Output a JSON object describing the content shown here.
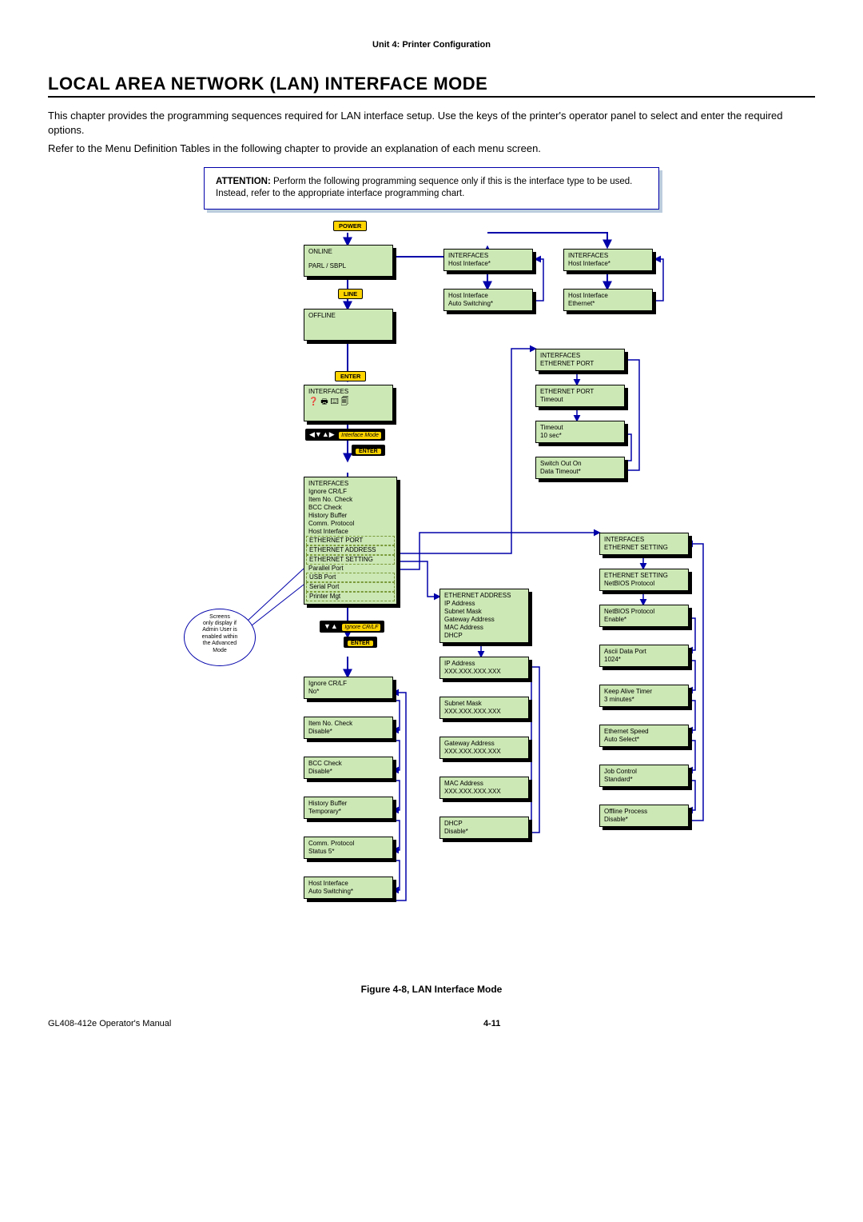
{
  "doc": {
    "unit": "Unit 4:  Printer Configuration",
    "heading": "LOCAL AREA NETWORK (LAN) INTERFACE MODE",
    "para1": "This chapter provides the programming sequences required for LAN interface setup. Use the keys of the printer's operator panel to select and enter the required options.",
    "para2": "Refer to the Menu Definition Tables in the following chapter to provide an explanation of each menu screen.",
    "attention_label": "ATTENTION:",
    "attention": " Perform the following programming sequence only if this is the interface type to be used. Instead, refer to the appropriate interface programming chart.",
    "fig_caption": "Figure 4-8, LAN Interface Mode",
    "footer_left": "GL408-412e Operator's Manual",
    "page_no": "4-11"
  },
  "buttons": {
    "power": "POWER",
    "line": "LINE",
    "enter": "ENTER",
    "interface_mode": "Interface Mode",
    "ignore_crlf": "Ignore CR/LF"
  },
  "col1": {
    "online_l1": "ONLINE",
    "online_l2": "PARL / SBPL",
    "offline": "OFFLINE",
    "interfaces": "INTERFACES",
    "list_title": "INTERFACES",
    "list": [
      "Ignore CR/LF",
      "Item No. Check",
      "BCC Check",
      "History Buffer",
      "Comm. Protocol",
      "Host Interface",
      "ETHERNET PORT",
      "ETHERNET ADDRESS",
      "ETHERNET SETTING",
      "Parallel Port",
      "USB Port",
      "Serial Port",
      "Printer Mgt"
    ],
    "n_ignore_l1": "Ignore CR/LF",
    "n_ignore_l2": "No*",
    "n_item_l1": "Item No. Check",
    "n_item_l2": "Disable*",
    "n_bcc_l1": "BCC Check",
    "n_bcc_l2": "Disable*",
    "n_hist_l1": "History Buffer",
    "n_hist_l2": "Temporary*",
    "n_comm_l1": "Comm. Protocol",
    "n_comm_l2": "Status 5*",
    "n_host_l1": "Host Interface",
    "n_host_l2": "Auto Switching*"
  },
  "col2a": {
    "if_l1": "INTERFACES",
    "if_l2": "Host Interface*",
    "hi_l1": "Host Interface",
    "hi_l2": "Auto Switching*"
  },
  "col2b": {
    "ep_l1": "INTERFACES",
    "ep_l2": "ETHERNET PORT",
    "ept_l1": "ETHERNET PORT",
    "ept_l2": "Timeout",
    "to_l1": "Timeout",
    "to_l2": "10  sec*",
    "so_l1": "Switch Out On",
    "so_l2": "Data Timeout*"
  },
  "col2c": {
    "ea_l1": "ETHERNET ADDRESS",
    "ea_items": [
      "IP Address",
      "Subnet Mask",
      "Gateway Address",
      "MAC Address",
      "DHCP"
    ],
    "ip_l1": "IP Address",
    "ip_l2": "XXX.XXX.XXX.XXX",
    "sm_l1": "Subnet Mask",
    "sm_l2": "XXX.XXX.XXX.XXX",
    "gw_l1": "Gateway Address",
    "gw_l2": "XXX.XXX.XXX.XXX",
    "mac_l1": "MAC Address",
    "mac_l2": "XXX.XXX.XXX.XXX",
    "dhcp_l1": "DHCP",
    "dhcp_l2": "Disable*"
  },
  "col3a": {
    "if_l1": "INTERFACES",
    "if_l2": "Host Interface*",
    "hi_l1": "Host Interface",
    "hi_l2": "Ethernet*"
  },
  "col3b": {
    "es_l1": "INTERFACES",
    "es_l2": "ETHERNET SETTING",
    "esn_l1": "ETHERNET SETTING",
    "esn_l2": "NetBIOS Protocol",
    "nb_l1": "NetBIOS Protocol",
    "nb_l2": "Enable*",
    "adp_l1": "Ascii Data Port",
    "adp_l2": "1024*",
    "kat_l1": "Keep Alive Timer",
    "kat_l2": "3 minutes*",
    "spd_l1": "Ethernet Speed",
    "spd_l2": "Auto Select*",
    "jc_l1": "Job Control",
    "jc_l2": "Standard*",
    "op_l1": "Offline Process",
    "op_l2": "Disable*"
  },
  "callout": {
    "l1": "Screens",
    "l2": "only display if",
    "l3": "Admin User is",
    "l4": "enabled within",
    "l5": "the Advanced",
    "l6": "Mode"
  }
}
